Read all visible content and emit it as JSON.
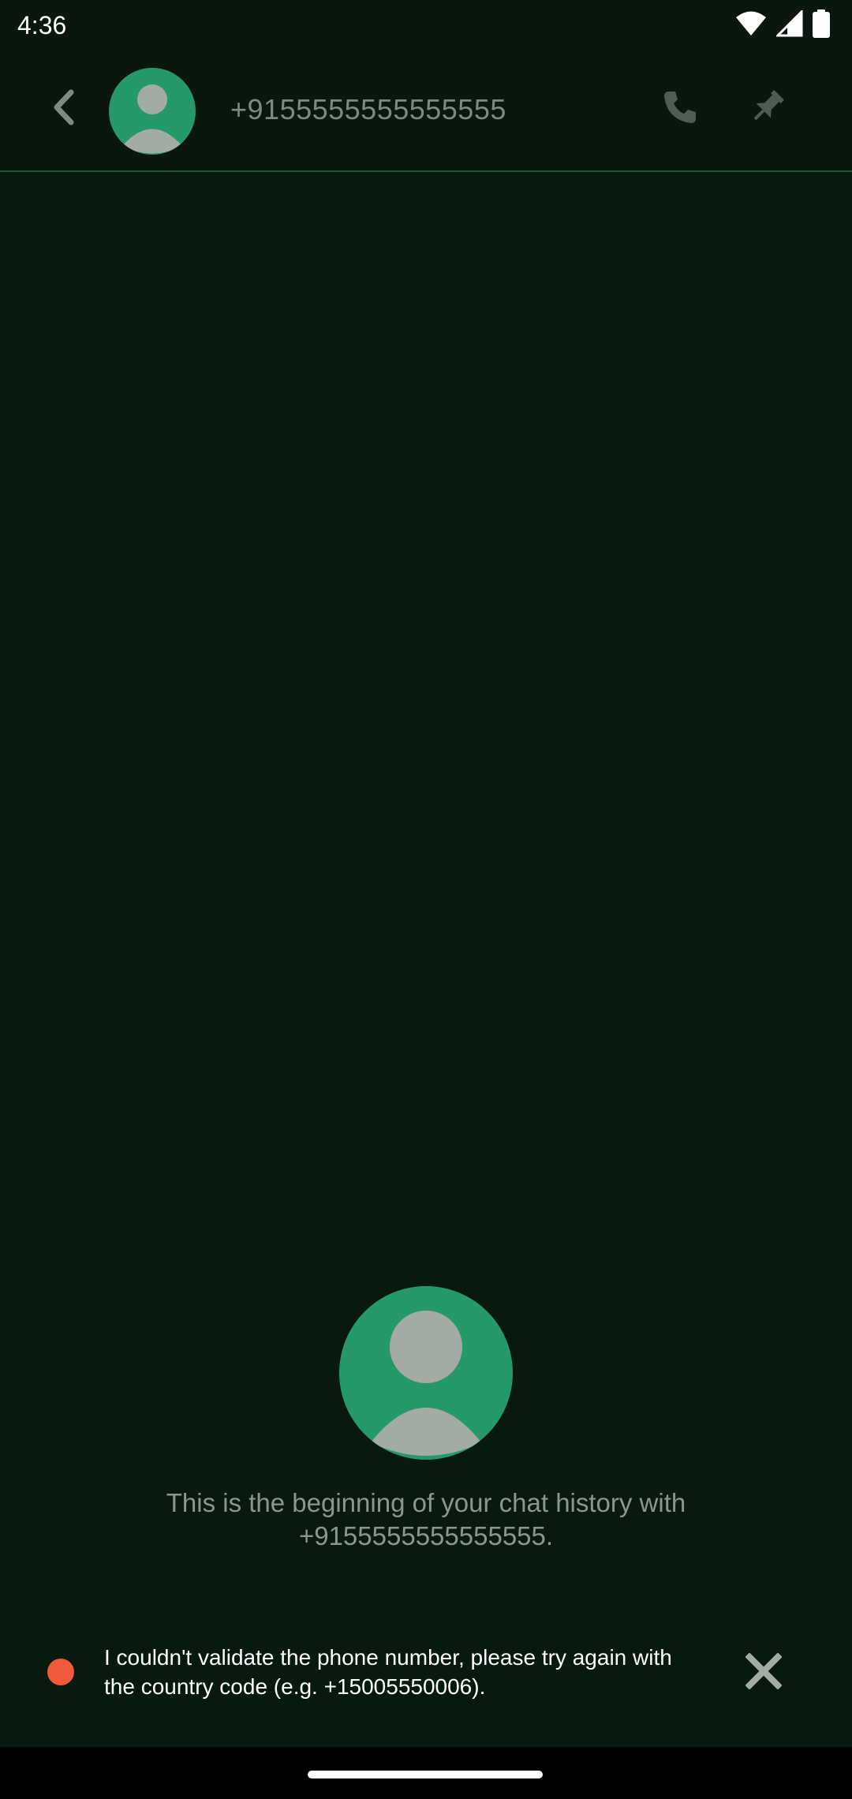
{
  "status_bar": {
    "time": "4:36",
    "icons": [
      "wifi-icon",
      "cell-signal-icon",
      "battery-icon"
    ]
  },
  "header": {
    "back_icon": "chevron-left-icon",
    "avatar_icon": "person-avatar-icon",
    "title": "+9155555555555555",
    "call_icon": "phone-icon",
    "pin_icon": "pin-icon"
  },
  "chat": {
    "avatar_icon": "person-avatar-icon",
    "history_line1": "This is the beginning of your chat history with",
    "history_line2": "+9155555555555555."
  },
  "error_banner": {
    "indicator_color": "#f05a3a",
    "message": "I couldn't validate the phone number, please try again with the country code (e.g. +15005550006).",
    "dismiss_icon": "close-icon"
  },
  "colors": {
    "background": "#081a0f",
    "accent": "#25996a",
    "error": "#f05a3a"
  }
}
